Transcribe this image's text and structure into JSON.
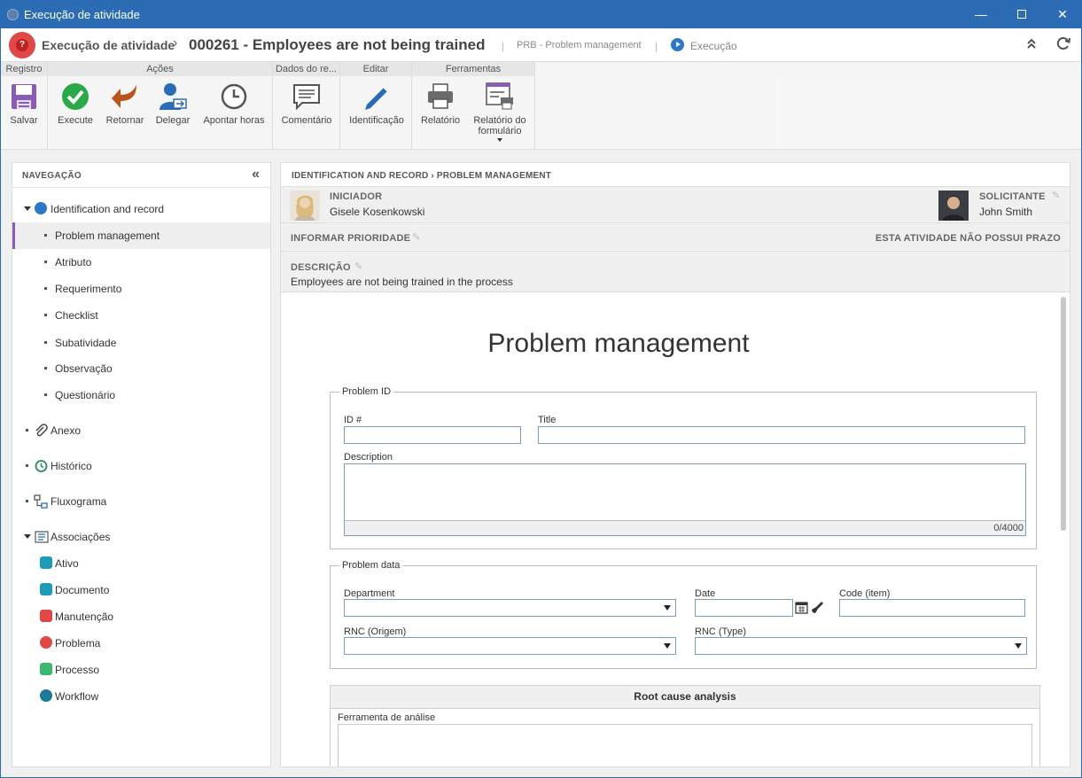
{
  "window": {
    "title": "Execução de atividade",
    "minimize": "—",
    "close": "✕"
  },
  "header": {
    "crumb": "Execução de atividade",
    "separator": "›",
    "title": "000261 - Employees are not being trained",
    "process": "PRB - Problem management",
    "status": "Execução",
    "pipe": "|"
  },
  "ribbon": {
    "groups": [
      {
        "label": "Registro",
        "buttons": [
          "Salvar"
        ]
      },
      {
        "label": "Ações",
        "buttons": [
          "Execute",
          "Retornar",
          "Delegar",
          "Apontar horas"
        ]
      },
      {
        "label": "Dados do re...",
        "buttons": [
          "Comentário"
        ]
      },
      {
        "label": "Editar",
        "buttons": [
          "Identificação"
        ]
      },
      {
        "label": "Ferramentas",
        "buttons": [
          "Relatório",
          "Relatório do formulário"
        ]
      }
    ]
  },
  "nav": {
    "title": "NAVEGAÇÃO",
    "collapse": "«",
    "items": [
      {
        "label": "Identification and record"
      },
      {
        "label": "Problem management"
      },
      {
        "label": "Atributo"
      },
      {
        "label": "Requerimento"
      },
      {
        "label": "Checklist"
      },
      {
        "label": "Subatividade"
      },
      {
        "label": "Observação"
      },
      {
        "label": "Questionário"
      },
      {
        "label": "Anexo"
      },
      {
        "label": "Histórico"
      },
      {
        "label": "Fluxograma"
      },
      {
        "label": "Associações"
      },
      {
        "label": "Ativo"
      },
      {
        "label": "Documento"
      },
      {
        "label": "Manutenção"
      },
      {
        "label": "Problema"
      },
      {
        "label": "Processo"
      },
      {
        "label": "Workflow"
      }
    ]
  },
  "content": {
    "breadcrumb": "IDENTIFICATION AND RECORD  ›  PROBLEM MANAGEMENT",
    "initiator_label": "INICIADOR",
    "initiator_name": "Gisele Kosenkowski",
    "requester_label": "SOLICITANTE",
    "requester_name": "John Smith",
    "priority_label": "INFORMAR PRIORIDADE",
    "deadline_text": "ESTA ATIVIDADE NÃO POSSUI PRAZO",
    "description_label": "DESCRIÇÃO",
    "description_value": "Employees are not being trained in the process"
  },
  "form": {
    "title": "Problem management",
    "problem_id": {
      "legend": "Problem ID",
      "id_label": "ID #",
      "title_label": "Title",
      "description_label": "Description",
      "counter": "0/4000"
    },
    "problem_data": {
      "legend": "Problem data",
      "department_label": "Department",
      "date_label": "Date",
      "code_label": "Code (item)",
      "rnc_origem_label": "RNC (Origem)",
      "rnc_type_label": "RNC (Type)"
    },
    "root_cause": {
      "title": "Root cause analysis",
      "tool_label": "Ferramenta de análise"
    }
  },
  "colors": {
    "titlebar": "#2b6cb5",
    "accent_purple": "#8a5cb8",
    "brand_red": "#e04848"
  }
}
